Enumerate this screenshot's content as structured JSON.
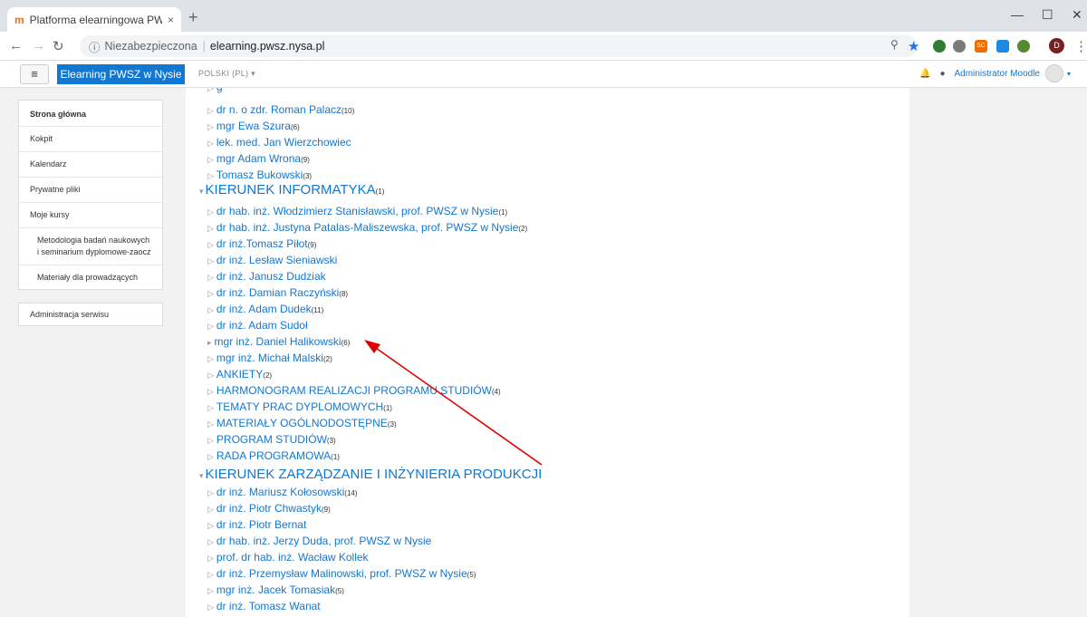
{
  "browser": {
    "tab_title": "Platforma elearningowa PWSZ w",
    "tab_close": "×",
    "new_tab": "+",
    "security_label": "Niezabezpieczona",
    "url": "elearning.pwsz.nysa.pl",
    "profile_initial": "D",
    "ext_label": "SC"
  },
  "header": {
    "brand": "Elearning PWSZ w Nysie",
    "language": "POLSKI (PL) ▾",
    "user_name": "Administrator Moodle"
  },
  "sidebar": {
    "items": [
      {
        "label": "Strona główna"
      },
      {
        "label": "Kokpit"
      },
      {
        "label": "Kalendarz"
      },
      {
        "label": "Prywatne pliki"
      },
      {
        "label": "Moje kursy"
      },
      {
        "label": "Metodologia badań naukowych i seminarium dyplomowe-zaocz"
      },
      {
        "label": "Materiały dla prowadzących"
      }
    ],
    "admin": "Administracja serwisu"
  },
  "tree": {
    "rows": [
      {
        "label": "dr n. o zdr. Roman Palacz",
        "count": "(10)"
      },
      {
        "label": "mgr Ewa Szura",
        "count": "(6)"
      },
      {
        "label": "lek. med. Jan Wierzchowiec",
        "count": ""
      },
      {
        "label": "mgr Adam Wrona",
        "count": "(9)"
      },
      {
        "label": "Tomasz Bukowski",
        "count": "(3)"
      },
      {
        "label": "KIERUNEK INFORMATYKA",
        "count": "(1)"
      },
      {
        "label": "dr hab. inż. Włodzimierz Stanisławski, prof. PWSZ w Nysie",
        "count": "(1)"
      },
      {
        "label": "dr hab. inż. Justyna Patalas-Maliszewska, prof. PWSZ w Nysie",
        "count": "(2)"
      },
      {
        "label": "dr inż.Tomasz Piłot",
        "count": "(9)"
      },
      {
        "label": "dr inż. Lesław Sieniawski",
        "count": ""
      },
      {
        "label": "dr inż. Janusz Dudziak",
        "count": ""
      },
      {
        "label": "dr inż. Damian Raczyński",
        "count": "(8)"
      },
      {
        "label": "dr inż. Adam Dudek",
        "count": "(11)"
      },
      {
        "label": "dr inż. Adam Sudoł",
        "count": ""
      },
      {
        "label": "mgr inż. Daniel Halikowski",
        "count": "(6)"
      },
      {
        "label": "mgr inż. Michał Malski",
        "count": "(2)"
      },
      {
        "label": "ANKIETY",
        "count": "(2)"
      },
      {
        "label": "HARMONOGRAM REALIZACJI PROGRAMU STUDIÓW",
        "count": "(4)"
      },
      {
        "label": "TEMATY PRAC DYPLOMOWYCH",
        "count": "(1)"
      },
      {
        "label": "MATERIAŁY OGÓLNODOSTĘPNE",
        "count": "(3)"
      },
      {
        "label": "PROGRAM STUDIÓW",
        "count": "(3)"
      },
      {
        "label": "RADA PROGRAMOWA",
        "count": "(1)"
      },
      {
        "label": "KIERUNEK ZARZĄDZANIE I INŻYNIERIA PRODUKCJI",
        "count": ""
      },
      {
        "label": "dr inż. Mariusz Kołosowski",
        "count": "(14)"
      },
      {
        "label": "dr inż. Piotr Chwastyk",
        "count": "(9)"
      },
      {
        "label": "dr inż. Piotr Bernat",
        "count": ""
      },
      {
        "label": "dr hab. inż. Jerzy Duda, prof. PWSZ w Nysie",
        "count": ""
      },
      {
        "label": "prof. dr hab. inż. Wacław Kollek",
        "count": ""
      },
      {
        "label": "dr inż. Przemysław Malinowski, prof. PWSZ w Nysie",
        "count": "(5)"
      },
      {
        "label": "mgr inż. Jacek Tomasiak",
        "count": "(5)"
      },
      {
        "label": "dr inż. Tomasz Wanat",
        "count": ""
      }
    ]
  },
  "colors": {
    "link": "#1177d1",
    "annotation_arrow": "#e00000"
  }
}
